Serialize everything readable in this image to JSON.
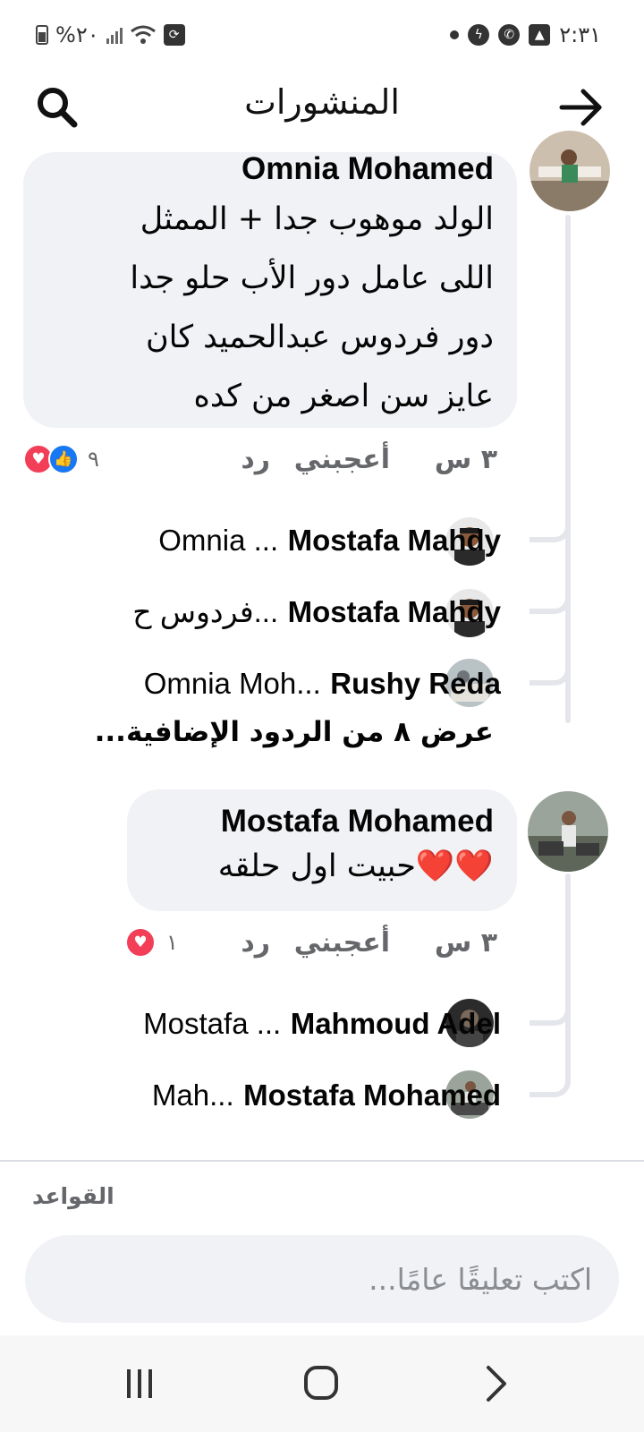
{
  "status_bar": {
    "battery": "%٢٠",
    "time": "٢:٣١"
  },
  "header": {
    "title": "المنشورات",
    "search_icon": "search-icon",
    "back_icon": "arrow-right-icon"
  },
  "comments": [
    {
      "author": "Omnia Mohamed",
      "text_lines": [
        "الولد موهوب جدا + الممثل",
        "اللى عامل دور الأب حلو جدا",
        "دور فردوس عبدالحميد كان",
        "عايز سن اصغر من كده"
      ],
      "time": "٣ س",
      "like": "أعجبني",
      "reply": "رد",
      "reaction_count": "٩",
      "reactions": [
        "like",
        "love"
      ],
      "replies": [
        {
          "name": "Mostafa Mahdy",
          "preview": "Omnia ..."
        },
        {
          "name": "Mostafa Mahdy",
          "preview": "فردوس ح..."
        },
        {
          "name": "Rushy Reda",
          "preview": "Omnia Moh..."
        }
      ],
      "more_replies": "عرض ٨ من الردود الإضافية..."
    },
    {
      "author": "Mostafa Mohamed",
      "text": "❤️❤️حبيت اول حلقه",
      "time": "٣ س",
      "like": "أعجبني",
      "reply": "رد",
      "reaction_count": "١",
      "reactions": [
        "love"
      ],
      "replies": [
        {
          "name": "Mahmoud Adel",
          "preview": "Mostafa ..."
        },
        {
          "name": "Mostafa Mohamed",
          "preview": "Mah..."
        }
      ]
    }
  ],
  "composer": {
    "rules_label": "القواعد",
    "placeholder": "اكتب تعليقًا عامًا..."
  },
  "colors": {
    "bubble": "#f0f2f5",
    "like_blue": "#1877f2",
    "love_red": "#f33e58",
    "muted_text": "#65676b"
  }
}
